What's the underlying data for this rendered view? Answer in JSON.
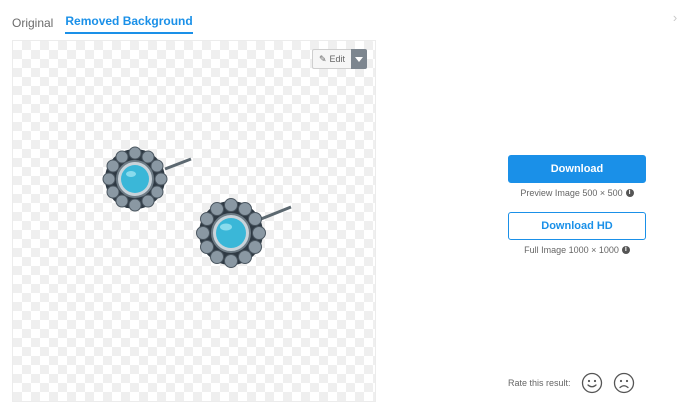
{
  "tabs": [
    {
      "label": "Original",
      "active": false
    },
    {
      "label": "Removed Background",
      "active": true
    }
  ],
  "close": {
    "icon": "close-icon",
    "glyph": "›"
  },
  "preview": {
    "edit_label": "Edit",
    "edit_icon": "pencil-icon",
    "dropdown_icon": "caret-down-icon"
  },
  "actions": {
    "download_label": "Download",
    "download_caption": "Preview Image 500 × 500",
    "download_hd_label": "Download HD",
    "download_hd_caption": "Full Image 1000 × 1000"
  },
  "rating": {
    "label": "Rate this result:",
    "good_icon": "smiley-face-icon",
    "bad_icon": "sad-face-icon"
  },
  "colors": {
    "accent": "#1a90e8",
    "earring_stone": "#3ab7d8",
    "earring_metal": "#7f8f9c"
  }
}
